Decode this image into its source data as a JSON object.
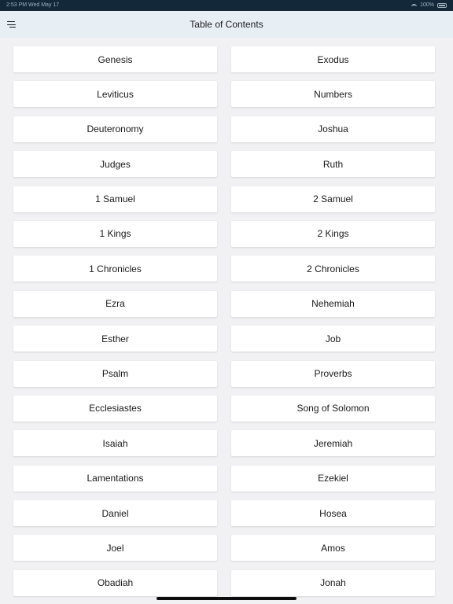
{
  "status_bar": {
    "left_text": "2:53 PM   Wed May 17",
    "battery_text": "100%"
  },
  "header": {
    "title": "Table of Contents",
    "menu_icon": "menu-icon"
  },
  "books": [
    {
      "label": "Genesis",
      "name": "book-button-genesis"
    },
    {
      "label": "Exodus",
      "name": "book-button-exodus"
    },
    {
      "label": "Leviticus",
      "name": "book-button-leviticus"
    },
    {
      "label": "Numbers",
      "name": "book-button-numbers"
    },
    {
      "label": "Deuteronomy",
      "name": "book-button-deuteronomy"
    },
    {
      "label": "Joshua",
      "name": "book-button-joshua"
    },
    {
      "label": "Judges",
      "name": "book-button-judges"
    },
    {
      "label": "Ruth",
      "name": "book-button-ruth"
    },
    {
      "label": "1 Samuel",
      "name": "book-button-1-samuel"
    },
    {
      "label": "2 Samuel",
      "name": "book-button-2-samuel"
    },
    {
      "label": "1 Kings",
      "name": "book-button-1-kings"
    },
    {
      "label": "2 Kings",
      "name": "book-button-2-kings"
    },
    {
      "label": "1 Chronicles",
      "name": "book-button-1-chronicles"
    },
    {
      "label": "2 Chronicles",
      "name": "book-button-2-chronicles"
    },
    {
      "label": "Ezra",
      "name": "book-button-ezra"
    },
    {
      "label": "Nehemiah",
      "name": "book-button-nehemiah"
    },
    {
      "label": "Esther",
      "name": "book-button-esther"
    },
    {
      "label": "Job",
      "name": "book-button-job"
    },
    {
      "label": "Psalm",
      "name": "book-button-psalm"
    },
    {
      "label": "Proverbs",
      "name": "book-button-proverbs"
    },
    {
      "label": "Ecclesiastes",
      "name": "book-button-ecclesiastes"
    },
    {
      "label": "Song of Solomon",
      "name": "book-button-song-of-solomon"
    },
    {
      "label": "Isaiah",
      "name": "book-button-isaiah"
    },
    {
      "label": "Jeremiah",
      "name": "book-button-jeremiah"
    },
    {
      "label": "Lamentations",
      "name": "book-button-lamentations"
    },
    {
      "label": "Ezekiel",
      "name": "book-button-ezekiel"
    },
    {
      "label": "Daniel",
      "name": "book-button-daniel"
    },
    {
      "label": "Hosea",
      "name": "book-button-hosea"
    },
    {
      "label": "Joel",
      "name": "book-button-joel"
    },
    {
      "label": "Amos",
      "name": "book-button-amos"
    },
    {
      "label": "Obadiah",
      "name": "book-button-obadiah"
    },
    {
      "label": "Jonah",
      "name": "book-button-jonah"
    }
  ],
  "colors": {
    "status_bar": "#13293a",
    "nav_bar": "#e7eef4",
    "background": "#f1f1f3",
    "button": "#ffffff",
    "text": "#1a1a1a"
  }
}
